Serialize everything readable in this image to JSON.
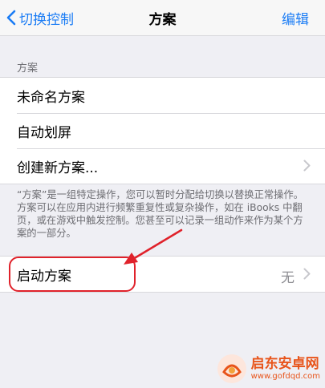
{
  "nav": {
    "back_label": "切换控制",
    "title": "方案",
    "edit_label": "编辑"
  },
  "section": {
    "header": "方案",
    "items": [
      {
        "label": "未命名方案"
      },
      {
        "label": "自动划屏"
      },
      {
        "label": "创建新方案..."
      }
    ],
    "footer": "“方案”是一组特定操作，您可以暂时分配给切换以替换正常操作。方案可以在应用内进行频繁重复性或复杂操作，如在 iBooks 中翻页，或在游戏中触发控制。您甚至可以记录一组动作来作为某个方案的一部分。"
  },
  "launch": {
    "label": "启动方案",
    "value": "无"
  },
  "watermark": {
    "name": "启东安卓网",
    "url": "www.gofdqd.com"
  },
  "colors": {
    "accent": "#1a7cf5",
    "highlight": "#e0222b",
    "watermark": "#e8541a"
  }
}
